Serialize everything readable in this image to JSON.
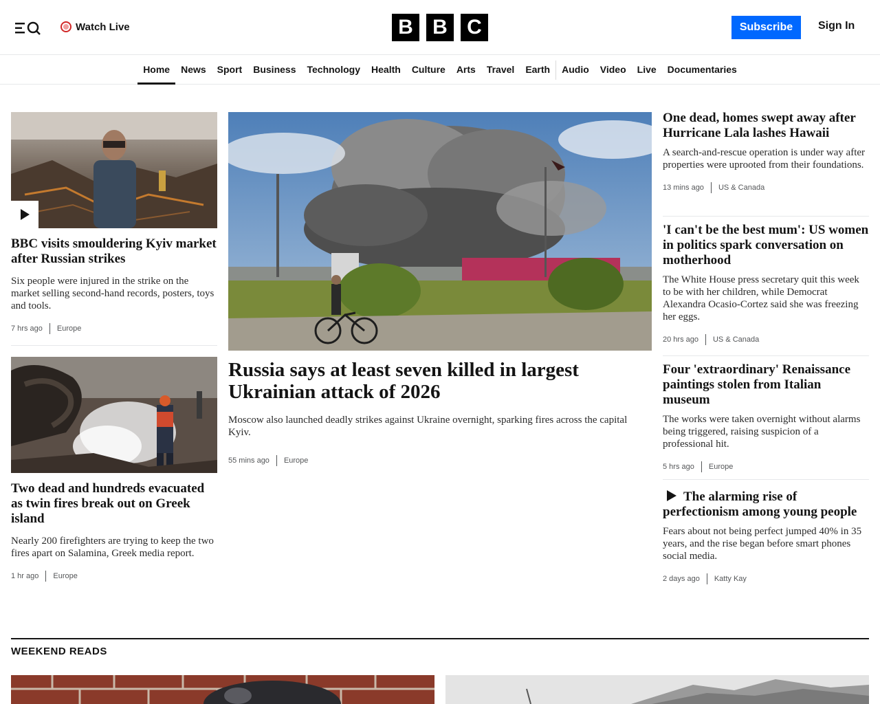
{
  "header": {
    "watch_live": "Watch Live",
    "logo_letters": [
      "B",
      "B",
      "C"
    ],
    "subscribe": "Subscribe",
    "sign_in": "Sign In"
  },
  "nav": {
    "items": [
      "Home",
      "News",
      "Sport",
      "Business",
      "Technology",
      "Health",
      "Culture",
      "Arts",
      "Travel",
      "Earth",
      "Audio",
      "Video",
      "Live",
      "Documentaries"
    ],
    "active": "Home"
  },
  "left": [
    {
      "title": "BBC visits smouldering Kyiv market after Russian strikes",
      "summary": "Six people were injured in the strike on the market selling second-hand records, posters, toys and tools.",
      "time": "7 hrs ago",
      "section": "Europe",
      "media": "play-icon"
    },
    {
      "title": "Two dead and hundreds evacuated as twin fires break out on Greek island",
      "summary": "Nearly 200 firefighters are trying to keep the two fires apart on Salamina, Greek media report.",
      "time": "1 hr ago",
      "section": "Europe"
    }
  ],
  "lead": {
    "title": "Russia says at least seven killed in largest Ukrainian attack of 2026",
    "summary": "Moscow also launched deadly strikes against Ukraine overnight, sparking fires across the capital Kyiv.",
    "time": "55 mins ago",
    "section": "Europe"
  },
  "right": [
    {
      "title": "One dead, homes swept away after Hurricane Lala lashes Hawaii",
      "summary": "A search-and-rescue operation is under way after properties were uprooted from their foundations.",
      "time": "13 mins ago",
      "section": "US & Canada"
    },
    {
      "title": "'I can't be the best mum': US women in politics spark conversation on motherhood",
      "summary": "The White House press secretary quit this week to be with her children, while Democrat Alexandra Ocasio-Cortez said she was freezing her eggs.",
      "time": "20 hrs ago",
      "section": "US & Canada"
    },
    {
      "title": "Four 'extraordinary' Renaissance paintings stolen from Italian museum",
      "summary": "The works were taken overnight without alarms being triggered, raising suspicion of a professional hit.",
      "time": "5 hrs ago",
      "section": "Europe"
    },
    {
      "title": "The alarming rise of perfectionism among young people",
      "summary": "Fears about not being perfect jumped 40% in 35 years, and the rise began before smart phones social media.",
      "time": "2 days ago",
      "section": "Katty Kay",
      "media": "play-icon"
    }
  ],
  "weekend": {
    "heading": "WEEKEND READS"
  },
  "colors": {
    "brand_blue": "#0068ff",
    "live_red": "#d12727",
    "text": "#141414",
    "divider": "#e6e8ea"
  }
}
